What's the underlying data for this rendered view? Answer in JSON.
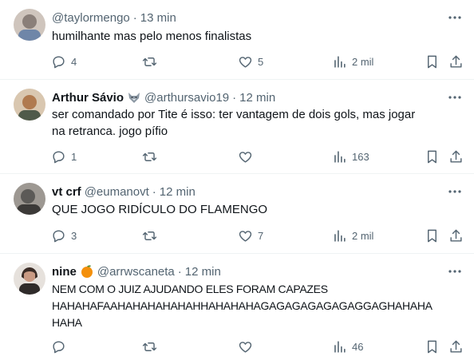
{
  "tweets": [
    {
      "name": "",
      "handle": "@taylormengo",
      "time": "13 min",
      "text": "humilhante mas pelo menos finalistas",
      "replies": "4",
      "retweets": "",
      "likes": "5",
      "views": "2 mil",
      "avatar_color": "#8a7f79"
    },
    {
      "name": "Arthur Sávio",
      "badge": "wolf-emoji",
      "handle": "@arthursavio19",
      "time": "12 min",
      "text": "ser comandado por Tite é isso: ter vantagem de dois gols, mas jogar na retranca. jogo pífio",
      "replies": "1",
      "retweets": "",
      "likes": "",
      "views": "163",
      "avatar_color": "#b07a4f"
    },
    {
      "name": "vt crf",
      "handle": "@eumanovt",
      "time": "12 min",
      "text": "QUE JOGO RIDÍCULO DO FLAMENGO",
      "replies": "3",
      "retweets": "",
      "likes": "7",
      "views": "2 mil",
      "avatar_color": "#5c5a57"
    },
    {
      "name": "nine",
      "badge": "orange-emoji",
      "handle": "@arrwscaneta",
      "time": "12 min",
      "text_lines": [
        "NEM COM O JUIZ AJUDANDO ELES FORAM CAPAZES",
        "HAHAHAFAAHAHAHAHAHAHHAHAHAHAGAGAGAGAGAGAGGAGHAHAHA",
        "HAHA"
      ],
      "replies": "",
      "retweets": "",
      "likes": "",
      "views": "46",
      "avatar_color": "#c99a83"
    }
  ],
  "sep": "·",
  "colors": {
    "text": "#0f1419",
    "secondary": "#536471",
    "divider": "#eff3f4"
  }
}
